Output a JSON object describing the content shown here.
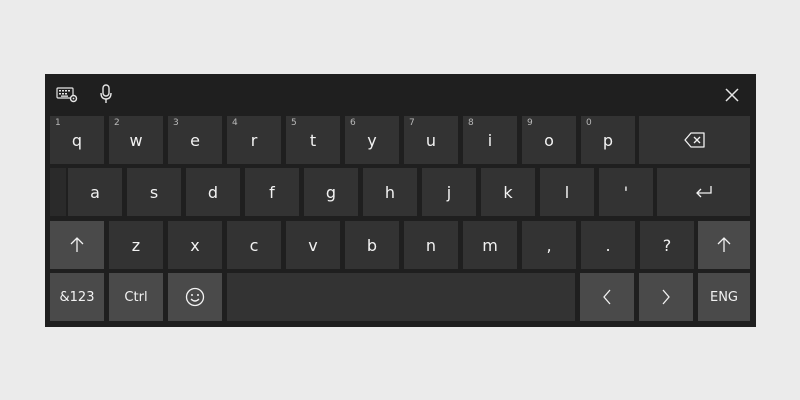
{
  "toolbar": {
    "keyboard_settings_icon": "keyboard-gear-icon",
    "microphone_icon": "microphone-icon",
    "close_icon": "close-icon"
  },
  "rows": {
    "row1": [
      {
        "label": "q",
        "hint": "1"
      },
      {
        "label": "w",
        "hint": "2"
      },
      {
        "label": "e",
        "hint": "3"
      },
      {
        "label": "r",
        "hint": "4"
      },
      {
        "label": "t",
        "hint": "5"
      },
      {
        "label": "y",
        "hint": "6"
      },
      {
        "label": "u",
        "hint": "7"
      },
      {
        "label": "i",
        "hint": "8"
      },
      {
        "label": "o",
        "hint": "9"
      },
      {
        "label": "p",
        "hint": "0"
      }
    ],
    "row2": [
      "a",
      "s",
      "d",
      "f",
      "g",
      "h",
      "j",
      "k",
      "l",
      "'"
    ],
    "row3": [
      "z",
      "x",
      "c",
      "v",
      "b",
      "n",
      "m",
      ",",
      ".",
      "?"
    ],
    "row4": {
      "symbols": "&123",
      "ctrl": "Ctrl",
      "language": "ENG"
    }
  },
  "icons": {
    "backspace": "backspace-icon",
    "enter": "enter-icon",
    "shift_left": "shift-icon",
    "shift_right": "shift-icon",
    "emoji": "emoji-icon",
    "arrow_left": "chevron-left-icon",
    "arrow_right": "chevron-right-icon"
  },
  "colors": {
    "page_background": "#ebebeb",
    "keyboard_background": "#1f1f1f",
    "key": "#333333",
    "special_key": "#4a4a4a",
    "text": "#f2f2f2"
  }
}
